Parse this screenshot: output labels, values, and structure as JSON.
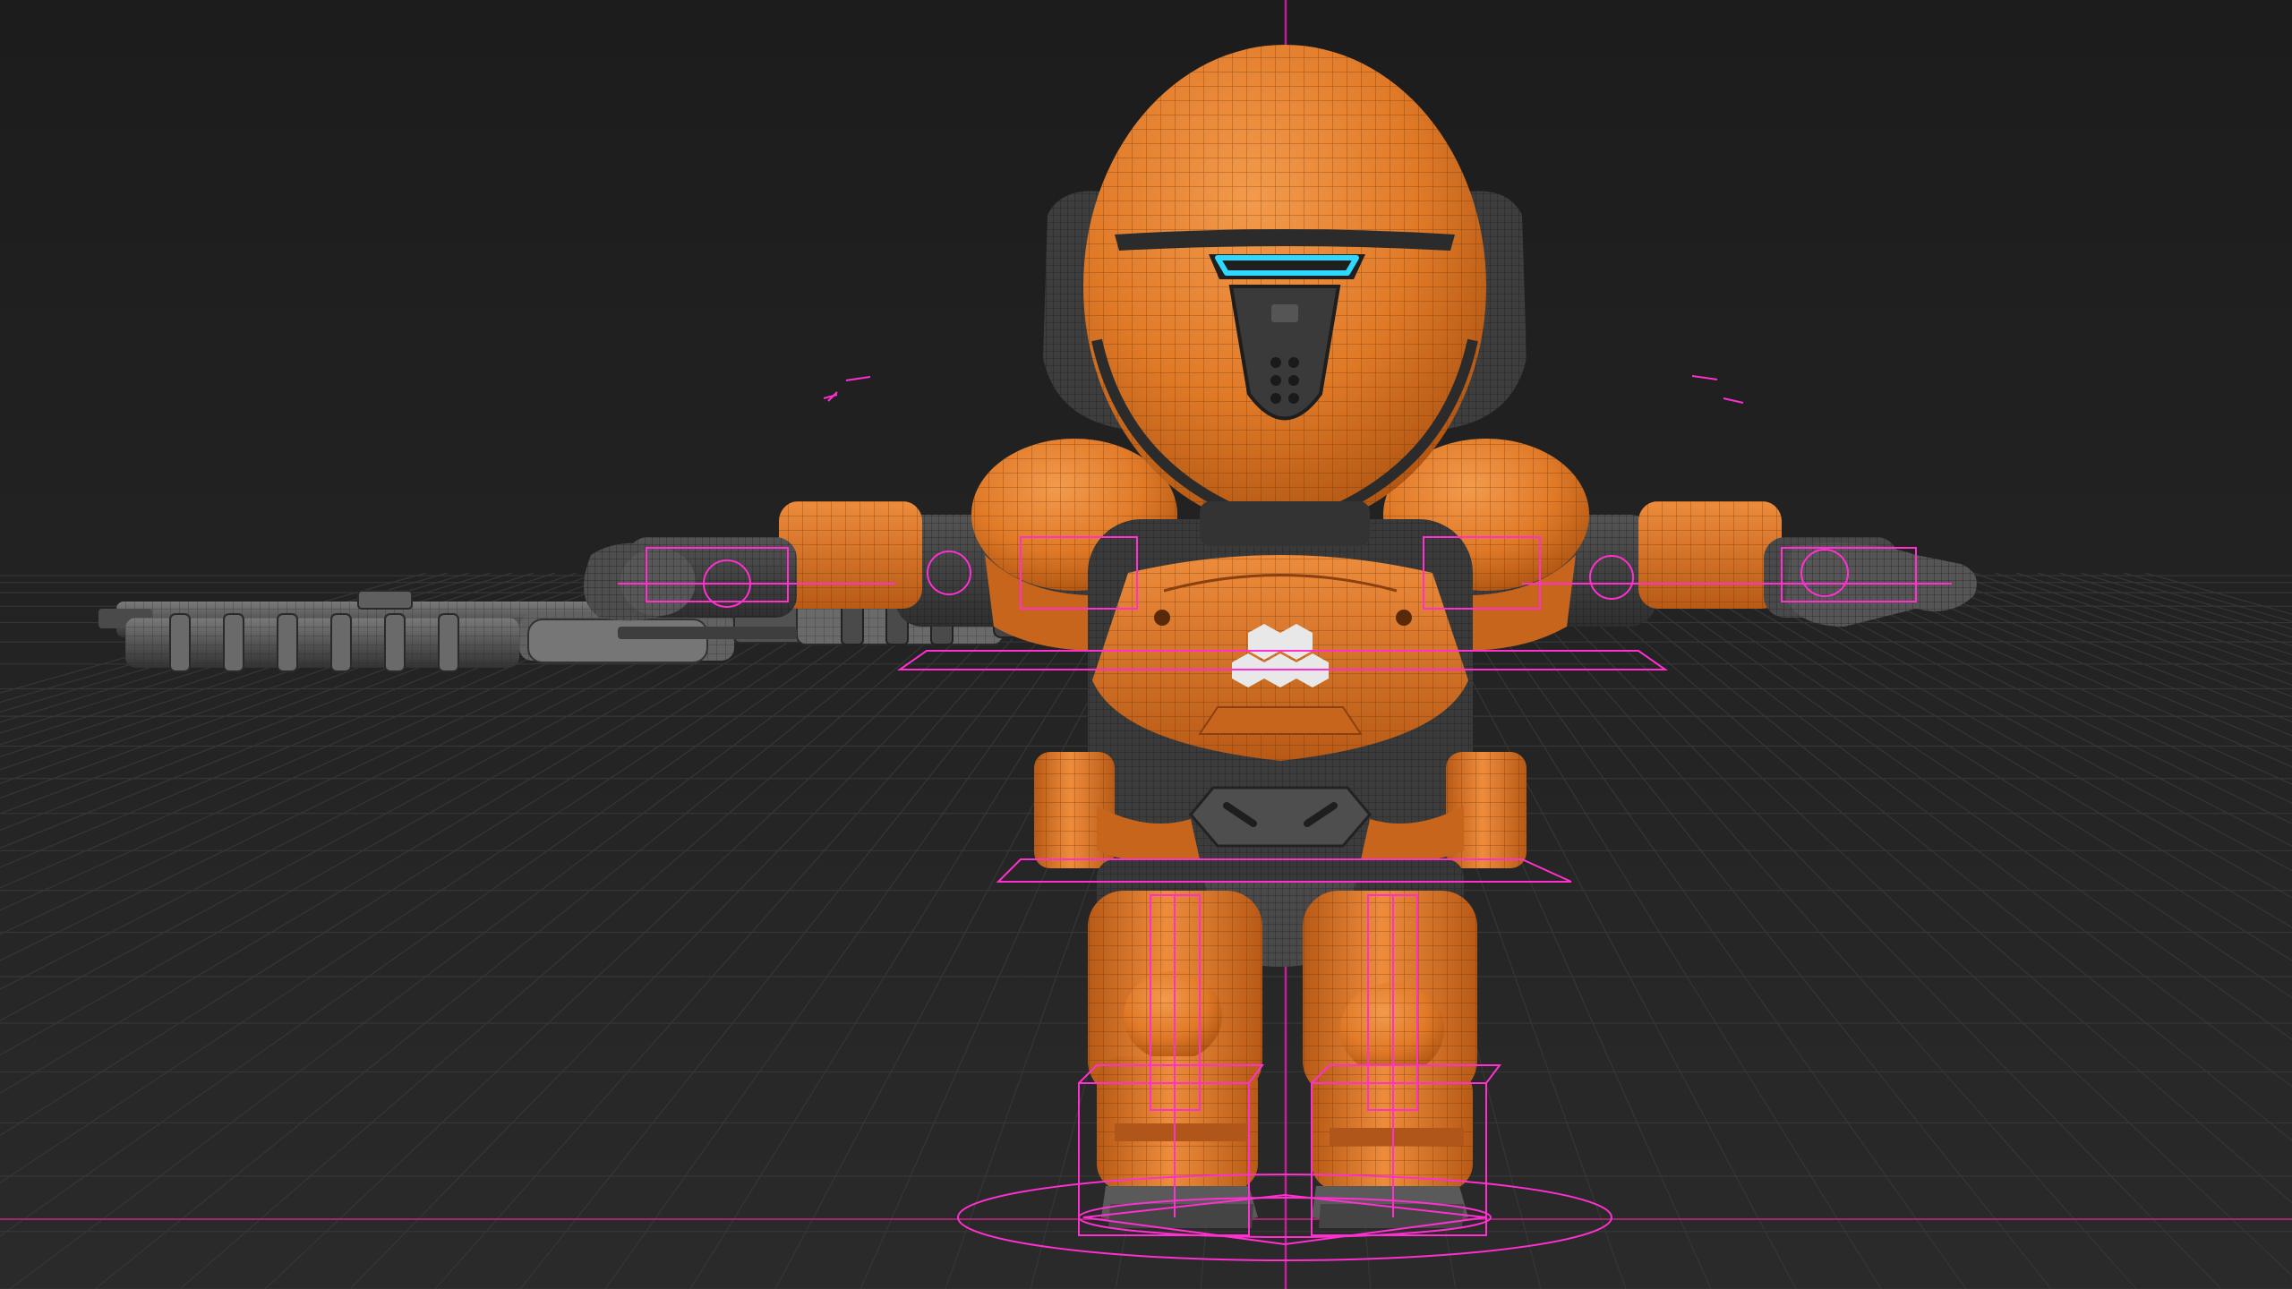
{
  "scene": {
    "subject": "robot-character",
    "view": "front-orthographic",
    "shading": "wireframe-on-shaded",
    "rig_overlay": true,
    "ground_grid": true
  },
  "colors": {
    "background_top": "#1c1c1c",
    "background_bottom": "#2a2a2a",
    "grid_line": "#363636",
    "armor_orange": "#e07a28",
    "armor_orange_dark": "#b85a16",
    "armor_gray": "#4a4a4a",
    "armor_gray_dark": "#2e2e2e",
    "wireframe_light": "#f2a560",
    "rig_magenta": "#ff2fd0",
    "visor_cyan": "#2fd8ff",
    "emblem_white": "#e8e8e8",
    "rifle_gray": "#5a5a5a"
  },
  "icons": {
    "chest_emblem": "hexagon-cluster-icon"
  }
}
